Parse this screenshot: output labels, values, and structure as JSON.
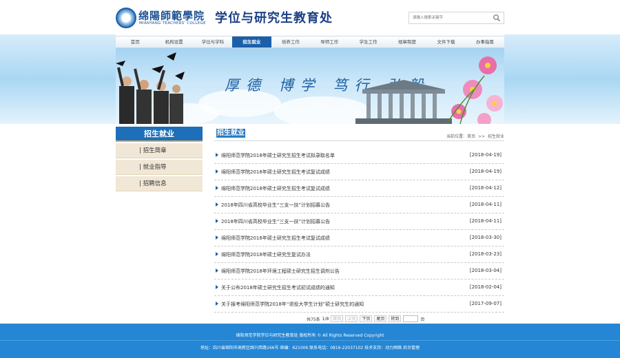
{
  "header": {
    "logo_cn": "绵陽師範學院",
    "logo_en": "MIANYANG TEACHERS' COLLEGE",
    "site_title": "学位与研究生教育处",
    "search_placeholder": "请输入搜索关键字"
  },
  "nav": {
    "items": [
      "首页",
      "机构设置",
      "学位与学科",
      "招生就业",
      "培养工作",
      "导师工作",
      "学生工作",
      "规章制度",
      "文件下载",
      "办事指南"
    ],
    "active_index": 3
  },
  "banner": {
    "slogan": "厚德 博学 笃行 弘毅"
  },
  "sidebar": {
    "title": "招生就业",
    "items": [
      "| 招生简章",
      "| 就业指导",
      "| 招聘信息"
    ]
  },
  "main": {
    "title": "招生就业",
    "breadcrumb_prefix": "当前位置:",
    "breadcrumb_home": "首页",
    "breadcrumb_sep": ">>",
    "breadcrumb_current": "招生就业",
    "news": [
      {
        "title": "绵阳师范学院2018年硕士研究生招生考试拟录取名单",
        "date": "[2018-04-19]"
      },
      {
        "title": "绵阳师范学院2018年硕士研究生招生考试复试成绩",
        "date": "[2018-04-19]"
      },
      {
        "title": "绵阳师范学院2018年硕士研究生招生考试复试成绩",
        "date": "[2018-04-12]"
      },
      {
        "title": "2018年四川省高校毕业生“三支一扶”计划招募公告",
        "date": "[2018-04-11]"
      },
      {
        "title": "2018年四川省高校毕业生“三支一扶”计划招募公告",
        "date": "[2018-04-11]"
      },
      {
        "title": "绵阳师范学院2018年硕士研究生招生考试复试成绩",
        "date": "[2018-03-30]"
      },
      {
        "title": "绵阳师范学院2018年硕士研究生复试办法",
        "date": "[2018-03-23]"
      },
      {
        "title": "绵阳师范学院2018年环境工程硕士研究生招生调剂公告",
        "date": "[2018-03-04]"
      },
      {
        "title": "关于公布2018年硕士研究生招生考试初试成绩的通知",
        "date": "[2018-02-04]"
      },
      {
        "title": "关于报考绵阳师范学院2018年“退役大学生计划”硕士研究生的通知",
        "date": "[2017-09-07]"
      }
    ]
  },
  "pager": {
    "total": "共75条",
    "page": "1/8",
    "first": "首页",
    "prev": "上页",
    "next": "下页",
    "last": "尾页",
    "goto": "转到",
    "page_unit": "页"
  },
  "footer": {
    "line1": "绵阳师范学院学位与研究生教育处 版权所有 © All Rights Reserved Copyright",
    "line2": "地址：四川省绵阳市高新区绵兴西路166号    邮编：621006  联系电话：0816-22037102  技术支持：动力网络  后台管理"
  },
  "colors": {
    "brand_blue": "#1c5fa8",
    "sidebar_head": "#1c6fb8",
    "sidebar_item": "#f1e7d6",
    "footer": "#2486d4"
  }
}
